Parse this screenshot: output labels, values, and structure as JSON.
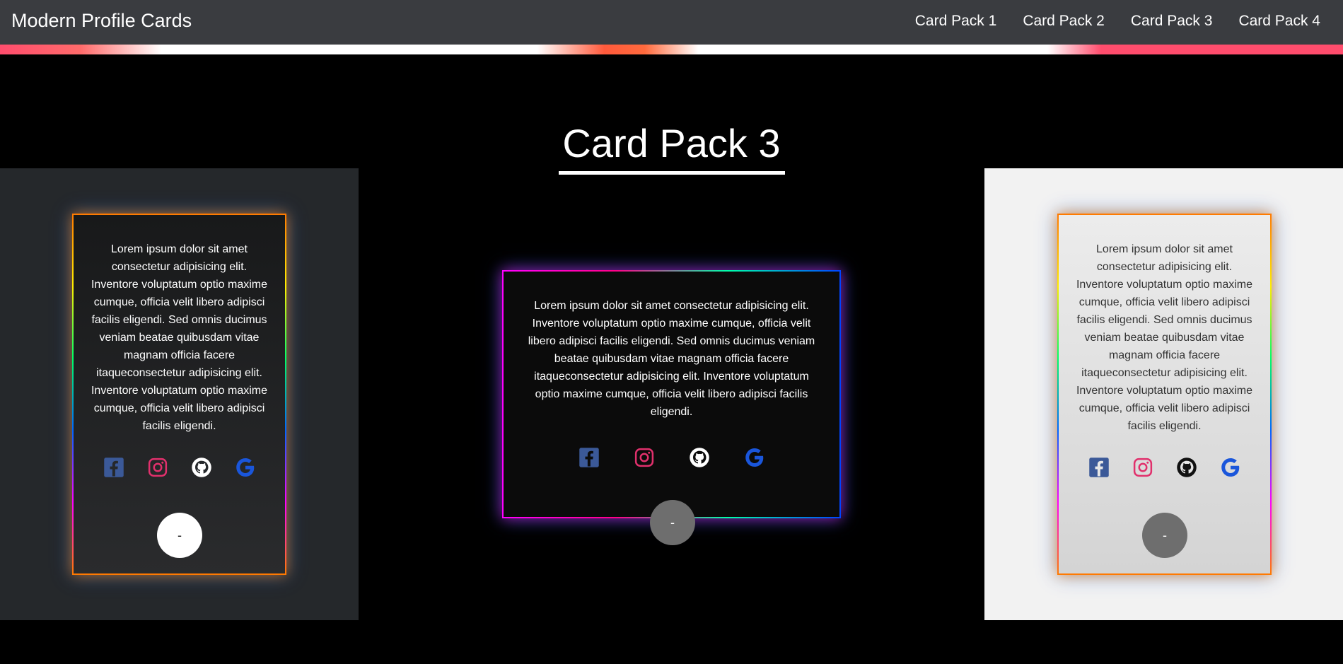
{
  "header": {
    "brand": "Modern Profile Cards",
    "nav": [
      "Card Pack 1",
      "Card Pack 2",
      "Card Pack 3",
      "Card Pack 4"
    ]
  },
  "page": {
    "title": "Card Pack 3"
  },
  "cards": [
    {
      "text": "Lorem ipsum dolor sit amet consectetur adipisicing elit. Inventore voluptatum optio maxime cumque, officia velit libero adipisci facilis eligendi. Sed omnis ducimus veniam beatae quibusdam vitae magnam officia facere itaqueconsectetur adipisicing elit. Inventore voluptatum optio maxime cumque, officia velit libero adipisci facilis eligendi.",
      "button": "-",
      "icons": [
        "facebook-icon",
        "instagram-icon",
        "github-icon",
        "google-icon"
      ]
    },
    {
      "text": "Lorem ipsum dolor sit amet consectetur adipisicing elit. Inventore voluptatum optio maxime cumque, officia velit libero adipisci facilis eligendi. Sed omnis ducimus veniam beatae quibusdam vitae magnam officia facere itaqueconsectetur adipisicing elit. Inventore voluptatum optio maxime cumque, officia velit libero adipisci facilis eligendi.",
      "button": "-",
      "icons": [
        "facebook-icon",
        "instagram-icon",
        "github-icon",
        "google-icon"
      ]
    },
    {
      "text": "Lorem ipsum dolor sit amet consectetur adipisicing elit. Inventore voluptatum optio maxime cumque, officia velit libero adipisci facilis eligendi. Sed omnis ducimus veniam beatae quibusdam vitae magnam officia facere itaqueconsectetur adipisicing elit. Inventore voluptatum optio maxime cumque, officia velit libero adipisci facilis eligendi.",
      "button": "-",
      "icons": [
        "facebook-icon",
        "instagram-icon",
        "github-icon",
        "google-icon"
      ]
    }
  ],
  "colors": {
    "facebook": "#3b5998",
    "instagram": "#e1306c",
    "google": "#1a56db",
    "github_dark_bg": "#ffffff",
    "github_light_bg": "#111111"
  }
}
